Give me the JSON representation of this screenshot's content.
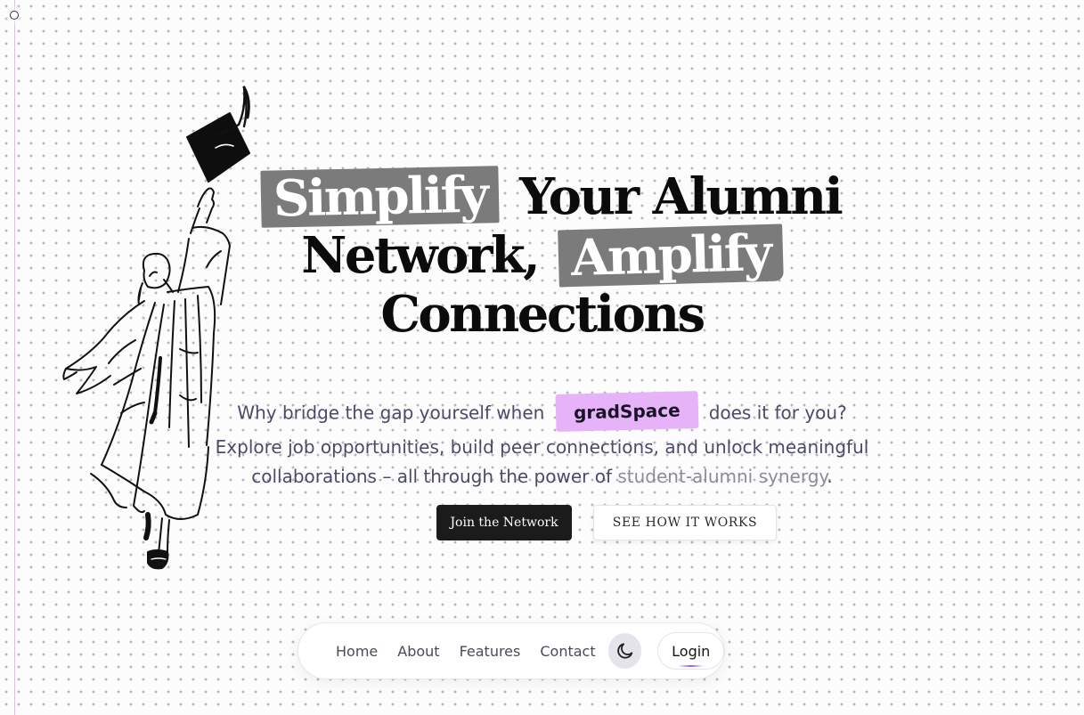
{
  "hero": {
    "title_highlight_1": "Simplify",
    "title_part_1": "Your Alumni",
    "title_part_2": "Network,",
    "title_highlight_2": "Amplify",
    "title_part_3": "Connections"
  },
  "subtitle": {
    "line1_prefix": "Why bridge the gap yourself when",
    "brand": "gradSpace",
    "line1_suffix": "does it for you?",
    "line2": "Explore job opportunities, build peer connections, and unlock meaningful",
    "line3_prefix": "collaborations – all through the power of",
    "line3_highlight": "student-alumni synergy",
    "line3_suffix": "."
  },
  "cta": {
    "primary_label": "Join the Network",
    "secondary_label": "SEE HOW IT WORKS"
  },
  "nav": {
    "items": [
      {
        "label": "Home"
      },
      {
        "label": "About"
      },
      {
        "label": "Features"
      },
      {
        "label": "Contact"
      }
    ],
    "theme_toggle_icon": "moon-icon",
    "login_label": "Login"
  },
  "illustration": {
    "subject": "graduate-tossing-cap-icon"
  },
  "colors": {
    "background": "#fdfcfd",
    "dot_pattern": "#b9b6bb",
    "title_highlight": "#7b7b7b",
    "brand_chip": "#e6b3f8",
    "primary_button": "#1b1b1b",
    "accent_line": "#e2b8f5"
  }
}
